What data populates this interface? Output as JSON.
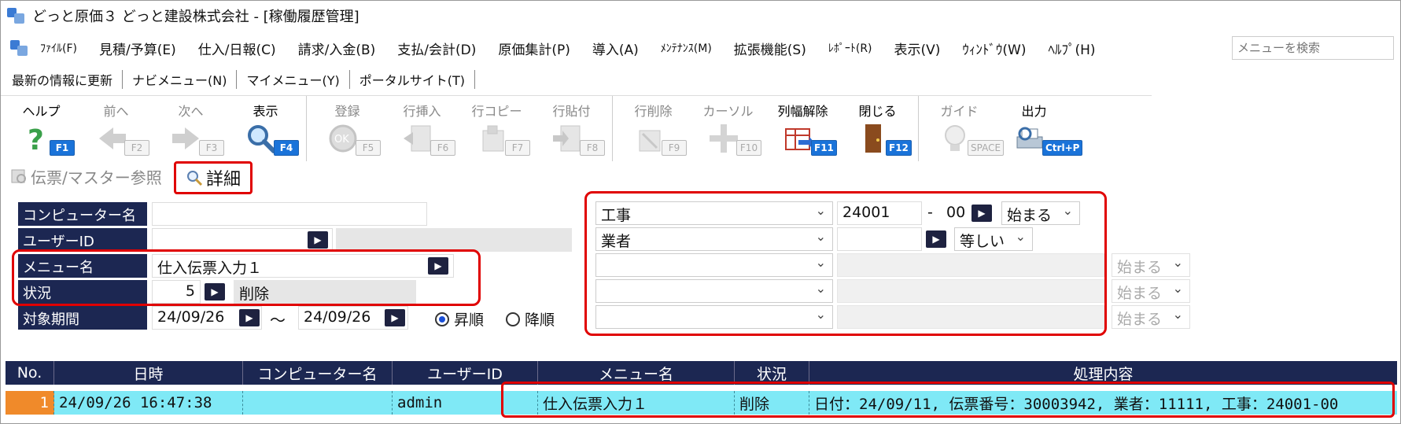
{
  "window": {
    "title": "どっと原価３ どっと建設株式会社 - [稼働履歴管理]"
  },
  "menu": {
    "items": [
      "ﾌｧｲﾙ(F)",
      "見積/予算(E)",
      "仕入/日報(C)",
      "請求/入金(B)",
      "支払/会計(D)",
      "原価集計(P)",
      "導入(A)",
      "ﾒﾝﾃﾅﾝｽ(M)",
      "拡張機能(S)",
      "ﾚﾎﾟｰﾄ(R)",
      "表示(V)",
      "ｳｨﾝﾄﾞｳ(W)",
      "ﾍﾙﾌﾟ(H)"
    ],
    "search_placeholder": "メニューを検索"
  },
  "subbar": {
    "items": [
      "最新の情報に更新",
      "ナビメニュー(N)",
      "マイメニュー(Y)",
      "ポータルサイト(T)"
    ]
  },
  "toolbar": {
    "buttons": [
      {
        "label": "ヘルプ",
        "key": "F1",
        "enabled": true,
        "icon": "help-icon"
      },
      {
        "label": "前へ",
        "key": "F2",
        "enabled": false,
        "icon": "prev-arrow-icon"
      },
      {
        "label": "次へ",
        "key": "F3",
        "enabled": false,
        "icon": "next-arrow-icon"
      },
      {
        "label": "表示",
        "key": "F4",
        "enabled": true,
        "icon": "magnifier-icon"
      },
      {
        "label": "登録",
        "key": "F5",
        "enabled": false,
        "icon": "ok-icon"
      },
      {
        "label": "行挿入",
        "key": "F6",
        "enabled": false,
        "icon": "row-insert-icon"
      },
      {
        "label": "行コピー",
        "key": "F7",
        "enabled": false,
        "icon": "row-copy-icon"
      },
      {
        "label": "行貼付",
        "key": "F8",
        "enabled": false,
        "icon": "row-paste-icon"
      },
      {
        "label": "行削除",
        "key": "F9",
        "enabled": false,
        "icon": "row-delete-icon"
      },
      {
        "label": "カーソル",
        "key": "F10",
        "enabled": false,
        "icon": "cursor-icon"
      },
      {
        "label": "列幅解除",
        "key": "F11",
        "enabled": true,
        "icon": "column-width-icon"
      },
      {
        "label": "閉じる",
        "key": "F12",
        "enabled": true,
        "icon": "door-icon"
      },
      {
        "label": "ガイド",
        "key": "SPACE",
        "enabled": false,
        "icon": "bulb-icon"
      },
      {
        "label": "出力",
        "key": "Ctrl+P",
        "enabled": true,
        "icon": "output-icon"
      }
    ]
  },
  "tabs": {
    "reference": "伝票/マスター参照",
    "detail": "詳細"
  },
  "form": {
    "computer_label": "コンピューター名",
    "user_label": "ユーザーID",
    "menu_label": "メニュー名",
    "menu_value": "仕入伝票入力１",
    "status_label": "状況",
    "status_code": "5",
    "status_text": "削除",
    "period_label": "対象期間",
    "period_from": "24/09/26",
    "period_sep": "～",
    "period_to": "24/09/26",
    "sort_asc": "昇順",
    "sort_desc": "降順"
  },
  "filters": [
    {
      "field": "工事",
      "value": "24001",
      "dash": "-",
      "sub": "00",
      "op": "始まる"
    },
    {
      "field": "業者",
      "value": "",
      "op": "等しい"
    },
    {
      "field": "",
      "op": "始まる"
    },
    {
      "field": "",
      "op": "始まる"
    },
    {
      "field": "",
      "op": "始まる"
    }
  ],
  "table": {
    "headers": [
      "No.",
      "日時",
      "コンピューター名",
      "ユーザーID",
      "メニュー名",
      "状況",
      "処理内容"
    ],
    "rows": [
      {
        "no": "1",
        "datetime": "24/09/26 16:47:38",
        "computer": "",
        "user": "admin",
        "menu": "仕入伝票入力１",
        "status": "削除",
        "detail": "日付：24/09/11, 伝票番号：30003942, 業者：11111, 工事：24001-00"
      }
    ]
  },
  "colors": {
    "header_navy": "#1c2752",
    "row_cyan": "#7fe9f6",
    "highlight_red": "#e00000",
    "row_number_orange": "#f08a2a",
    "fkey_blue": "#1a73d9"
  }
}
